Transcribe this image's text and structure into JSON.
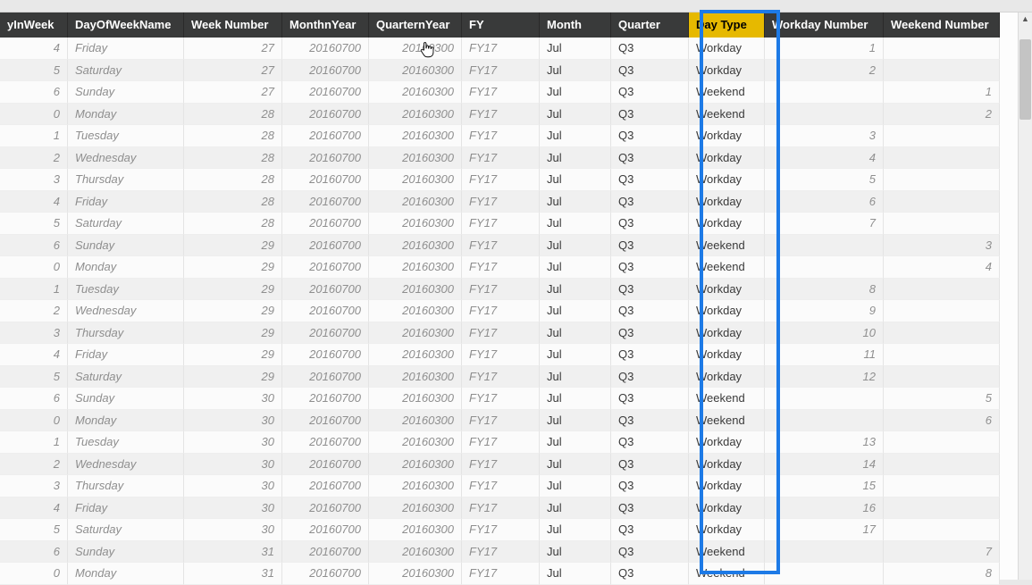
{
  "columns": [
    {
      "key": "dayInWeek",
      "label": "yInWeek",
      "type": "num",
      "interactable": true
    },
    {
      "key": "dayName",
      "label": "DayOfWeekName",
      "type": "txt",
      "interactable": true
    },
    {
      "key": "weekNum",
      "label": "Week Number",
      "type": "num",
      "interactable": true
    },
    {
      "key": "monthnYear",
      "label": "MonthnYear",
      "type": "num",
      "interactable": true
    },
    {
      "key": "quarternYear",
      "label": "QuarternYear",
      "type": "num",
      "interactable": true
    },
    {
      "key": "fy",
      "label": "FY",
      "type": "txt",
      "interactable": true
    },
    {
      "key": "month",
      "label": "Month",
      "type": "dk",
      "interactable": true
    },
    {
      "key": "quarter",
      "label": "Quarter",
      "type": "dk",
      "interactable": true
    },
    {
      "key": "dayType",
      "label": "Day Type",
      "type": "dk",
      "interactable": true,
      "selected": true
    },
    {
      "key": "workdayNum",
      "label": "Workday Number",
      "type": "num",
      "interactable": true
    },
    {
      "key": "weekendNum",
      "label": "Weekend Number",
      "type": "num",
      "interactable": true
    }
  ],
  "rows": [
    {
      "dayInWeek": 4,
      "dayName": "Friday",
      "weekNum": 27,
      "monthnYear": "20160700",
      "quarternYear": "20160300",
      "fy": "FY17",
      "month": "Jul",
      "quarter": "Q3",
      "dayType": "Workday",
      "workdayNum": 1,
      "weekendNum": ""
    },
    {
      "dayInWeek": 5,
      "dayName": "Saturday",
      "weekNum": 27,
      "monthnYear": "20160700",
      "quarternYear": "20160300",
      "fy": "FY17",
      "month": "Jul",
      "quarter": "Q3",
      "dayType": "Workday",
      "workdayNum": 2,
      "weekendNum": ""
    },
    {
      "dayInWeek": 6,
      "dayName": "Sunday",
      "weekNum": 27,
      "monthnYear": "20160700",
      "quarternYear": "20160300",
      "fy": "FY17",
      "month": "Jul",
      "quarter": "Q3",
      "dayType": "Weekend",
      "workdayNum": "",
      "weekendNum": 1
    },
    {
      "dayInWeek": 0,
      "dayName": "Monday",
      "weekNum": 28,
      "monthnYear": "20160700",
      "quarternYear": "20160300",
      "fy": "FY17",
      "month": "Jul",
      "quarter": "Q3",
      "dayType": "Weekend",
      "workdayNum": "",
      "weekendNum": 2
    },
    {
      "dayInWeek": 1,
      "dayName": "Tuesday",
      "weekNum": 28,
      "monthnYear": "20160700",
      "quarternYear": "20160300",
      "fy": "FY17",
      "month": "Jul",
      "quarter": "Q3",
      "dayType": "Workday",
      "workdayNum": 3,
      "weekendNum": ""
    },
    {
      "dayInWeek": 2,
      "dayName": "Wednesday",
      "weekNum": 28,
      "monthnYear": "20160700",
      "quarternYear": "20160300",
      "fy": "FY17",
      "month": "Jul",
      "quarter": "Q3",
      "dayType": "Workday",
      "workdayNum": 4,
      "weekendNum": ""
    },
    {
      "dayInWeek": 3,
      "dayName": "Thursday",
      "weekNum": 28,
      "monthnYear": "20160700",
      "quarternYear": "20160300",
      "fy": "FY17",
      "month": "Jul",
      "quarter": "Q3",
      "dayType": "Workday",
      "workdayNum": 5,
      "weekendNum": ""
    },
    {
      "dayInWeek": 4,
      "dayName": "Friday",
      "weekNum": 28,
      "monthnYear": "20160700",
      "quarternYear": "20160300",
      "fy": "FY17",
      "month": "Jul",
      "quarter": "Q3",
      "dayType": "Workday",
      "workdayNum": 6,
      "weekendNum": ""
    },
    {
      "dayInWeek": 5,
      "dayName": "Saturday",
      "weekNum": 28,
      "monthnYear": "20160700",
      "quarternYear": "20160300",
      "fy": "FY17",
      "month": "Jul",
      "quarter": "Q3",
      "dayType": "Workday",
      "workdayNum": 7,
      "weekendNum": ""
    },
    {
      "dayInWeek": 6,
      "dayName": "Sunday",
      "weekNum": 29,
      "monthnYear": "20160700",
      "quarternYear": "20160300",
      "fy": "FY17",
      "month": "Jul",
      "quarter": "Q3",
      "dayType": "Weekend",
      "workdayNum": "",
      "weekendNum": 3
    },
    {
      "dayInWeek": 0,
      "dayName": "Monday",
      "weekNum": 29,
      "monthnYear": "20160700",
      "quarternYear": "20160300",
      "fy": "FY17",
      "month": "Jul",
      "quarter": "Q3",
      "dayType": "Weekend",
      "workdayNum": "",
      "weekendNum": 4
    },
    {
      "dayInWeek": 1,
      "dayName": "Tuesday",
      "weekNum": 29,
      "monthnYear": "20160700",
      "quarternYear": "20160300",
      "fy": "FY17",
      "month": "Jul",
      "quarter": "Q3",
      "dayType": "Workday",
      "workdayNum": 8,
      "weekendNum": ""
    },
    {
      "dayInWeek": 2,
      "dayName": "Wednesday",
      "weekNum": 29,
      "monthnYear": "20160700",
      "quarternYear": "20160300",
      "fy": "FY17",
      "month": "Jul",
      "quarter": "Q3",
      "dayType": "Workday",
      "workdayNum": 9,
      "weekendNum": ""
    },
    {
      "dayInWeek": 3,
      "dayName": "Thursday",
      "weekNum": 29,
      "monthnYear": "20160700",
      "quarternYear": "20160300",
      "fy": "FY17",
      "month": "Jul",
      "quarter": "Q3",
      "dayType": "Workday",
      "workdayNum": 10,
      "weekendNum": ""
    },
    {
      "dayInWeek": 4,
      "dayName": "Friday",
      "weekNum": 29,
      "monthnYear": "20160700",
      "quarternYear": "20160300",
      "fy": "FY17",
      "month": "Jul",
      "quarter": "Q3",
      "dayType": "Workday",
      "workdayNum": 11,
      "weekendNum": ""
    },
    {
      "dayInWeek": 5,
      "dayName": "Saturday",
      "weekNum": 29,
      "monthnYear": "20160700",
      "quarternYear": "20160300",
      "fy": "FY17",
      "month": "Jul",
      "quarter": "Q3",
      "dayType": "Workday",
      "workdayNum": 12,
      "weekendNum": ""
    },
    {
      "dayInWeek": 6,
      "dayName": "Sunday",
      "weekNum": 30,
      "monthnYear": "20160700",
      "quarternYear": "20160300",
      "fy": "FY17",
      "month": "Jul",
      "quarter": "Q3",
      "dayType": "Weekend",
      "workdayNum": "",
      "weekendNum": 5
    },
    {
      "dayInWeek": 0,
      "dayName": "Monday",
      "weekNum": 30,
      "monthnYear": "20160700",
      "quarternYear": "20160300",
      "fy": "FY17",
      "month": "Jul",
      "quarter": "Q3",
      "dayType": "Weekend",
      "workdayNum": "",
      "weekendNum": 6
    },
    {
      "dayInWeek": 1,
      "dayName": "Tuesday",
      "weekNum": 30,
      "monthnYear": "20160700",
      "quarternYear": "20160300",
      "fy": "FY17",
      "month": "Jul",
      "quarter": "Q3",
      "dayType": "Workday",
      "workdayNum": 13,
      "weekendNum": ""
    },
    {
      "dayInWeek": 2,
      "dayName": "Wednesday",
      "weekNum": 30,
      "monthnYear": "20160700",
      "quarternYear": "20160300",
      "fy": "FY17",
      "month": "Jul",
      "quarter": "Q3",
      "dayType": "Workday",
      "workdayNum": 14,
      "weekendNum": ""
    },
    {
      "dayInWeek": 3,
      "dayName": "Thursday",
      "weekNum": 30,
      "monthnYear": "20160700",
      "quarternYear": "20160300",
      "fy": "FY17",
      "month": "Jul",
      "quarter": "Q3",
      "dayType": "Workday",
      "workdayNum": 15,
      "weekendNum": ""
    },
    {
      "dayInWeek": 4,
      "dayName": "Friday",
      "weekNum": 30,
      "monthnYear": "20160700",
      "quarternYear": "20160300",
      "fy": "FY17",
      "month": "Jul",
      "quarter": "Q3",
      "dayType": "Workday",
      "workdayNum": 16,
      "weekendNum": ""
    },
    {
      "dayInWeek": 5,
      "dayName": "Saturday",
      "weekNum": 30,
      "monthnYear": "20160700",
      "quarternYear": "20160300",
      "fy": "FY17",
      "month": "Jul",
      "quarter": "Q3",
      "dayType": "Workday",
      "workdayNum": 17,
      "weekendNum": ""
    },
    {
      "dayInWeek": 6,
      "dayName": "Sunday",
      "weekNum": 31,
      "monthnYear": "20160700",
      "quarternYear": "20160300",
      "fy": "FY17",
      "month": "Jul",
      "quarter": "Q3",
      "dayType": "Weekend",
      "workdayNum": "",
      "weekendNum": 7
    },
    {
      "dayInWeek": 0,
      "dayName": "Monday",
      "weekNum": 31,
      "monthnYear": "20160700",
      "quarternYear": "20160300",
      "fy": "FY17",
      "month": "Jul",
      "quarter": "Q3",
      "dayType": "Weekend",
      "workdayNum": "",
      "weekendNum": 8
    }
  ]
}
